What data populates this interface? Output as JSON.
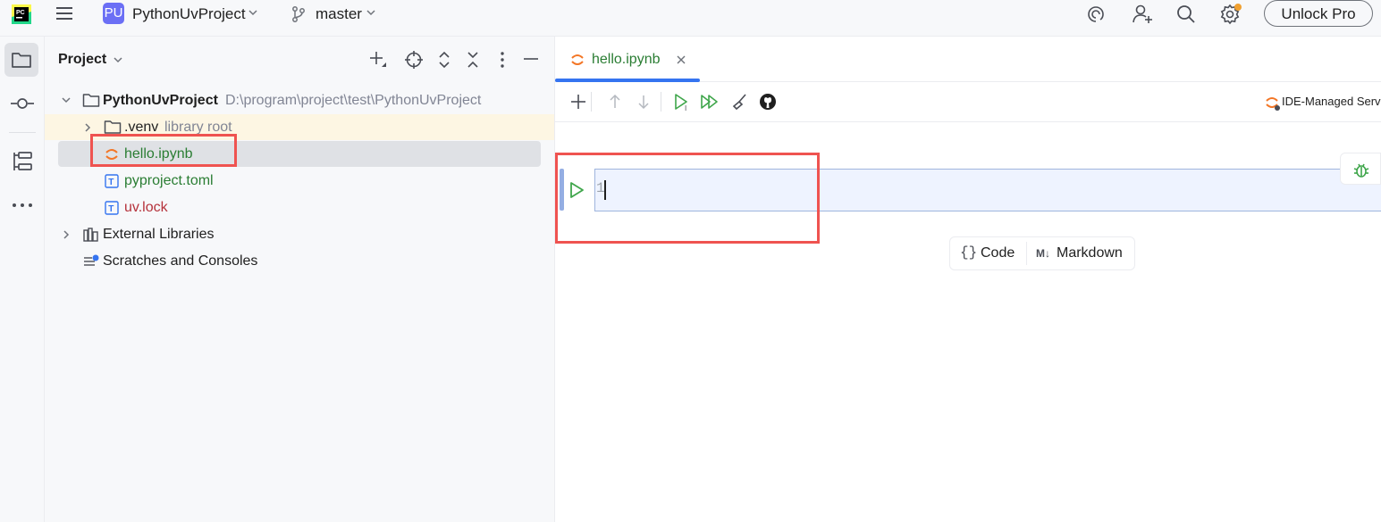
{
  "titlebar": {
    "project_badge": "PU",
    "project_name": "PythonUvProject",
    "branch": "master",
    "unlock_label": "Unlock Pro"
  },
  "project_panel": {
    "title": "Project",
    "tree": {
      "root_name": "PythonUvProject",
      "root_path": "D:\\program\\project\\test\\PythonUvProject",
      "venv_name": ".venv",
      "venv_hint": "library root",
      "file_notebook": "hello.ipynb",
      "file_pyproject": "pyproject.toml",
      "file_lock": "uv.lock",
      "external_libraries": "External Libraries",
      "scratches": "Scratches and Consoles"
    }
  },
  "editor": {
    "tab_label": "hello.ipynb",
    "server_label": "IDE-Managed Serv",
    "cell_content": "1",
    "add_code_label": "Code",
    "add_markdown_label": "Markdown",
    "markdown_prefix": "M↓"
  },
  "colors": {
    "accent": "#3574f0",
    "run_green": "#3fa64b",
    "notebook_orange": "#f37626",
    "file_green": "#2a7d33",
    "file_red": "#b5323b",
    "highlight_red": "#ef5350"
  },
  "icons": [
    "pycharm-logo-icon",
    "hamburger-menu-icon",
    "vcs-branch-icon",
    "ai-spiral-icon",
    "add-user-icon",
    "search-icon",
    "settings-gear-icon",
    "folder-icon",
    "commit-icon",
    "structure-icon",
    "more-icon",
    "new-file-icon",
    "locate-icon",
    "expand-all-icon",
    "collapse-all-icon",
    "options-icon",
    "minimize-icon",
    "jupyter-icon",
    "toml-file-icon",
    "library-icon",
    "scratches-icon",
    "add-cell-icon",
    "move-up-icon",
    "move-down-icon",
    "run-cell-icon",
    "run-all-icon",
    "clear-outputs-icon",
    "github-icon",
    "debug-bug-icon"
  ]
}
